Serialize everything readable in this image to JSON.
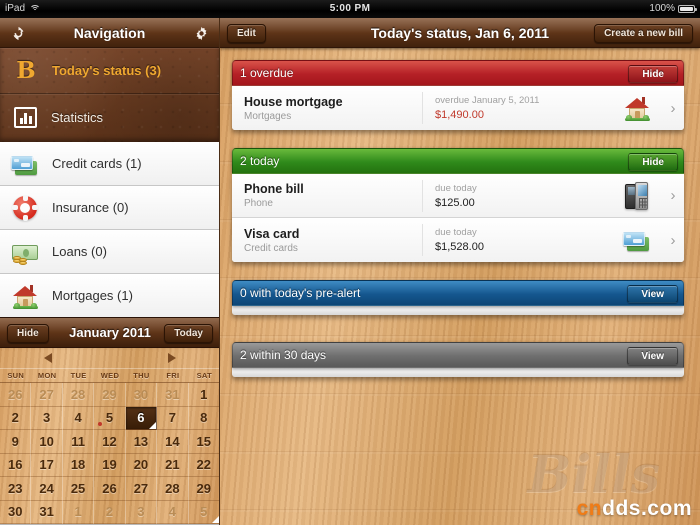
{
  "status_bar": {
    "carrier": "iPad",
    "wifi_icon": "wifi-icon",
    "time": "5:00 PM",
    "battery_pct": "100%"
  },
  "sidebar": {
    "nav_title": "Navigation",
    "sync_icon": "sync-icon",
    "settings_icon": "gear-icon",
    "primary_items": [
      {
        "label": "Today's status (3)",
        "icon": "bills-b-logo-icon",
        "active": true
      },
      {
        "label": "Statistics",
        "icon": "bar-chart-icon",
        "active": false
      }
    ],
    "categories": [
      {
        "label": "Credit cards (1)",
        "icon": "credit-cards-icon"
      },
      {
        "label": "Insurance (0)",
        "icon": "life-preserver-icon"
      },
      {
        "label": "Loans (0)",
        "icon": "money-icon"
      },
      {
        "label": "Mortgages (1)",
        "icon": "house-icon"
      }
    ]
  },
  "calendar": {
    "hide_label": "Hide",
    "title": "January 2011",
    "today_label": "Today",
    "prev_icon": "triangle-left-icon",
    "next_icon": "triangle-right-icon",
    "day_headers": [
      "SUN",
      "MON",
      "TUE",
      "WED",
      "THU",
      "FRI",
      "SAT"
    ],
    "weeks": [
      [
        {
          "d": "26",
          "muted": true
        },
        {
          "d": "27",
          "muted": true
        },
        {
          "d": "28",
          "muted": true
        },
        {
          "d": "29",
          "muted": true
        },
        {
          "d": "30",
          "muted": true
        },
        {
          "d": "31",
          "muted": true
        },
        {
          "d": "1",
          "muted": false
        }
      ],
      [
        {
          "d": "2"
        },
        {
          "d": "3"
        },
        {
          "d": "4"
        },
        {
          "d": "5",
          "dot": true
        },
        {
          "d": "6",
          "selected": true,
          "corner": true
        },
        {
          "d": "7"
        },
        {
          "d": "8"
        }
      ],
      [
        {
          "d": "9"
        },
        {
          "d": "10"
        },
        {
          "d": "11"
        },
        {
          "d": "12"
        },
        {
          "d": "13"
        },
        {
          "d": "14"
        },
        {
          "d": "15"
        }
      ],
      [
        {
          "d": "16"
        },
        {
          "d": "17"
        },
        {
          "d": "18"
        },
        {
          "d": "19"
        },
        {
          "d": "20"
        },
        {
          "d": "21"
        },
        {
          "d": "22"
        }
      ],
      [
        {
          "d": "23"
        },
        {
          "d": "24"
        },
        {
          "d": "25"
        },
        {
          "d": "26"
        },
        {
          "d": "27"
        },
        {
          "d": "28"
        },
        {
          "d": "29"
        }
      ],
      [
        {
          "d": "30"
        },
        {
          "d": "31"
        },
        {
          "d": "1",
          "muted": true
        },
        {
          "d": "2",
          "muted": true
        },
        {
          "d": "3",
          "muted": true
        },
        {
          "d": "4",
          "muted": true
        },
        {
          "d": "5",
          "muted": true,
          "corner": true
        }
      ]
    ]
  },
  "toolbar": {
    "edit_label": "Edit",
    "title": "Today's status, Jan 6, 2011",
    "create_label": "Create a new bill"
  },
  "sections": [
    {
      "id": "overdue",
      "title": "1 overdue",
      "color": "#b52026",
      "style": "head-red",
      "button": "Hide",
      "bills": [
        {
          "name": "House mortgage",
          "category": "Mortgages",
          "due": "overdue January 5, 2011",
          "amount": "$1,490.00",
          "amount_overdue": true,
          "icon": "house-icon"
        }
      ]
    },
    {
      "id": "today",
      "title": "2 today",
      "color": "#2f8a1b",
      "style": "head-green",
      "button": "Hide",
      "bills": [
        {
          "name": "Phone bill",
          "category": "Phone",
          "due": "due today",
          "amount": "$125.00",
          "amount_overdue": false,
          "icon": "phone-icon"
        },
        {
          "name": "Visa card",
          "category": "Credit cards",
          "due": "due today",
          "amount": "$1,528.00",
          "amount_overdue": false,
          "icon": "credit-cards-icon"
        }
      ]
    },
    {
      "id": "prealert",
      "title": "0 with today's pre-alert",
      "color": "#15578f",
      "style": "head-blue",
      "button": "View",
      "bills": []
    },
    {
      "id": "within30",
      "title": "2 within 30 days",
      "color": "#6e6e6e",
      "style": "head-gray",
      "button": "View",
      "bills": []
    }
  ],
  "watermarks": {
    "app": "Bills",
    "site_white": "cn",
    "site_orange_part": "dds.com"
  }
}
